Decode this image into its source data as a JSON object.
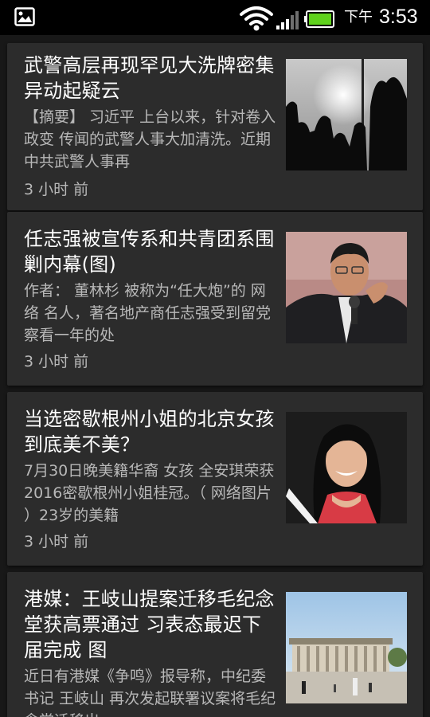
{
  "status_bar": {
    "ampm": "下午",
    "time": "3:53"
  },
  "icons": {
    "gallery": "gallery-icon",
    "wifi": "wifi-icon",
    "signal": "signal-strength-icon",
    "battery": "battery-charging-icon"
  },
  "colors": {
    "status_bar_bg": "#000000",
    "page_bg": "#181818",
    "card_bg": "#2c2c2c",
    "title_text": "#ffffff",
    "summary_text": "#b8b8b8",
    "battery_green": "#5fd11c"
  },
  "articles": [
    {
      "title": "武警高层再现罕见大洗牌密集异动起疑云",
      "summary": "【摘要】 习近平 上台以来，针对卷入 政变 传闻的武警人事大加清洗。近期中共武警人事再",
      "time": "3 小时 前",
      "thumbnail": "soldiers-silhouette-thumbnail"
    },
    {
      "title": "任志强被宣传系和共青团系围剿内幕(图)",
      "summary": "作者： 董林杉 被称为“任大炮”的 网络 名人，著名地产商任志强受到留党察看一年的处",
      "time": "3 小时 前",
      "thumbnail": "man-with-microphone-thumbnail"
    },
    {
      "title": "当选密歇根州小姐的北京女孩到底美不美？",
      "summary": "7月30日晚美籍华裔 女孩 全安琪荣获2016密歇根州小姐桂冠。（ 网络图片 ）23岁的美籍",
      "time": "3 小时 前",
      "thumbnail": "pageant-winner-thumbnail"
    },
    {
      "title": "港媒：王岐山提案迁移毛纪念堂获高票通过 习表态最迟下届完成 图",
      "summary": "近日有港媒《争鸣》报导称，中纪委书记 王岐山 再次发起联署议案将毛纪念堂迁移出",
      "time": "",
      "thumbnail": "memorial-hall-thumbnail"
    }
  ]
}
